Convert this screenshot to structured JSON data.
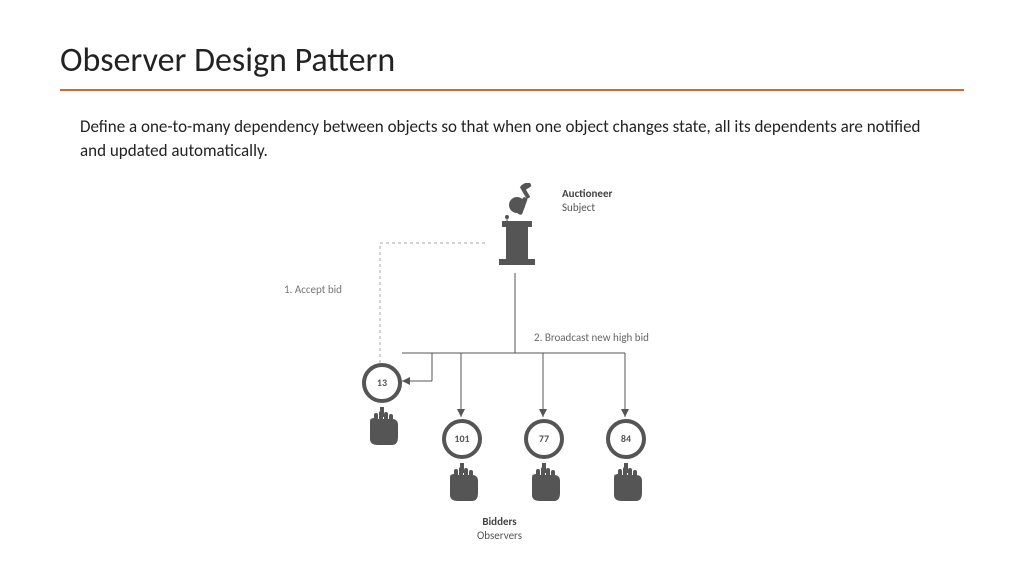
{
  "title": "Observer Design Pattern",
  "definition": "Define a one-to-many dependency between objects so that when one object changes state, all its dependents are notified and updated automatically.",
  "diagram": {
    "subject": {
      "label_bold": "Auctioneer",
      "label_normal": "Subject"
    },
    "step1_label": "1. Accept bid",
    "step2_label": "2. Broadcast new high bid",
    "bidders": [
      {
        "number": "13"
      },
      {
        "number": "101"
      },
      {
        "number": "77"
      },
      {
        "number": "84"
      }
    ],
    "observers": {
      "label_bold": "Bidders",
      "label_normal": "Observers"
    }
  }
}
